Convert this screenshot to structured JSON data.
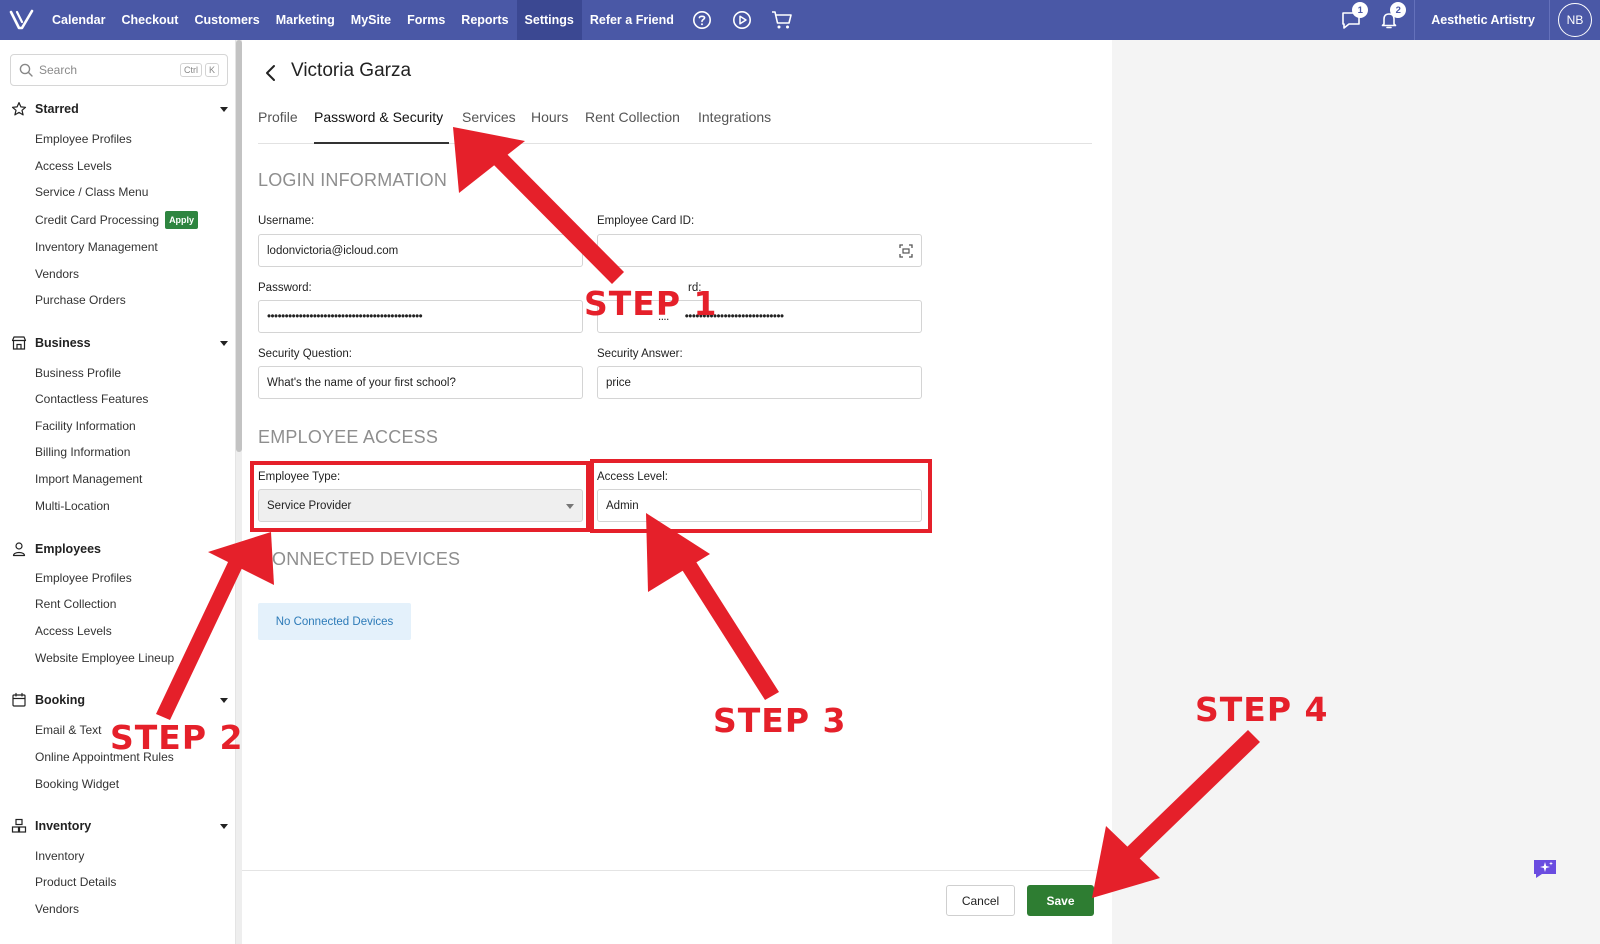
{
  "topnav": {
    "items": [
      "Calendar",
      "Checkout",
      "Customers",
      "Marketing",
      "MySite",
      "Forms",
      "Reports",
      "Settings",
      "Refer a Friend"
    ],
    "active": "Settings",
    "icons": [
      "help-icon",
      "play-icon",
      "cart-icon"
    ],
    "messages_badge": "1",
    "notifications_badge": "2",
    "business_name": "Aesthetic Artistry",
    "avatar_initials": "NB"
  },
  "sidebar": {
    "search_placeholder": "Search",
    "search_kbd": [
      "Ctrl",
      "K"
    ],
    "sections": [
      {
        "title": "Starred",
        "icon": "star-icon",
        "items": [
          "Employee Profiles",
          "Access Levels",
          "Service / Class Menu",
          "Credit Card Processing",
          "Inventory Management",
          "Vendors",
          "Purchase Orders"
        ]
      },
      {
        "title": "Business",
        "icon": "storefront-icon",
        "items": [
          "Business Profile",
          "Contactless Features",
          "Facility Information",
          "Billing Information",
          "Import Management",
          "Multi-Location"
        ]
      },
      {
        "title": "Employees",
        "icon": "person-icon",
        "items": [
          "Employee Profiles",
          "Rent Collection",
          "Access Levels",
          "Website Employee Lineup"
        ]
      },
      {
        "title": "Booking",
        "icon": "calendar-icon",
        "items": [
          "Email & Text",
          "Online Appointment Rules",
          "Booking Widget"
        ]
      },
      {
        "title": "Inventory",
        "icon": "boxes-icon",
        "items": [
          "Inventory",
          "Product Details",
          "Vendors"
        ]
      }
    ],
    "apply_badge": "Apply"
  },
  "page": {
    "title": "Victoria Garza",
    "tabs": [
      "Profile",
      "Password & Security",
      "Services",
      "Hours",
      "Rent Collection",
      "Integrations"
    ],
    "active_tab": "Password & Security"
  },
  "login": {
    "heading": "LOGIN INFORMATION",
    "username_label": "Username:",
    "username_value": "lodonvictoria@icloud.com",
    "card_id_label": "Employee Card ID:",
    "card_id_value": "",
    "password_label": "Password:",
    "password_value": "••••••••••••••••••••••••••••••••••••••••••••",
    "confirm_label_partial": "rd:",
    "confirm_dots_partial": "....",
    "confirm_value": "••••••••••••••••••••••••••••",
    "question_label": "Security Question:",
    "question_value": "What's the name of your first school?",
    "answer_label": "Security Answer:",
    "answer_value": "price"
  },
  "access": {
    "heading": "EMPLOYEE ACCESS",
    "type_label": "Employee Type:",
    "type_value": "Service Provider",
    "level_label": "Access Level:",
    "level_value": "Admin"
  },
  "devices": {
    "heading": "ONNECTED DEVICES",
    "empty_text": "No Connected Devices"
  },
  "footer": {
    "cancel_label": "Cancel",
    "save_label": "Save"
  },
  "annotations": {
    "step1": "STEP 1",
    "step2": "STEP 2",
    "step3": "STEP 3",
    "step4": "STEP 4",
    "color": "#e5202a"
  },
  "colors": {
    "nav": "#4a58a6",
    "save": "#2e7d32",
    "apply": "#2e8540",
    "info_box": "#e4f1fb"
  }
}
